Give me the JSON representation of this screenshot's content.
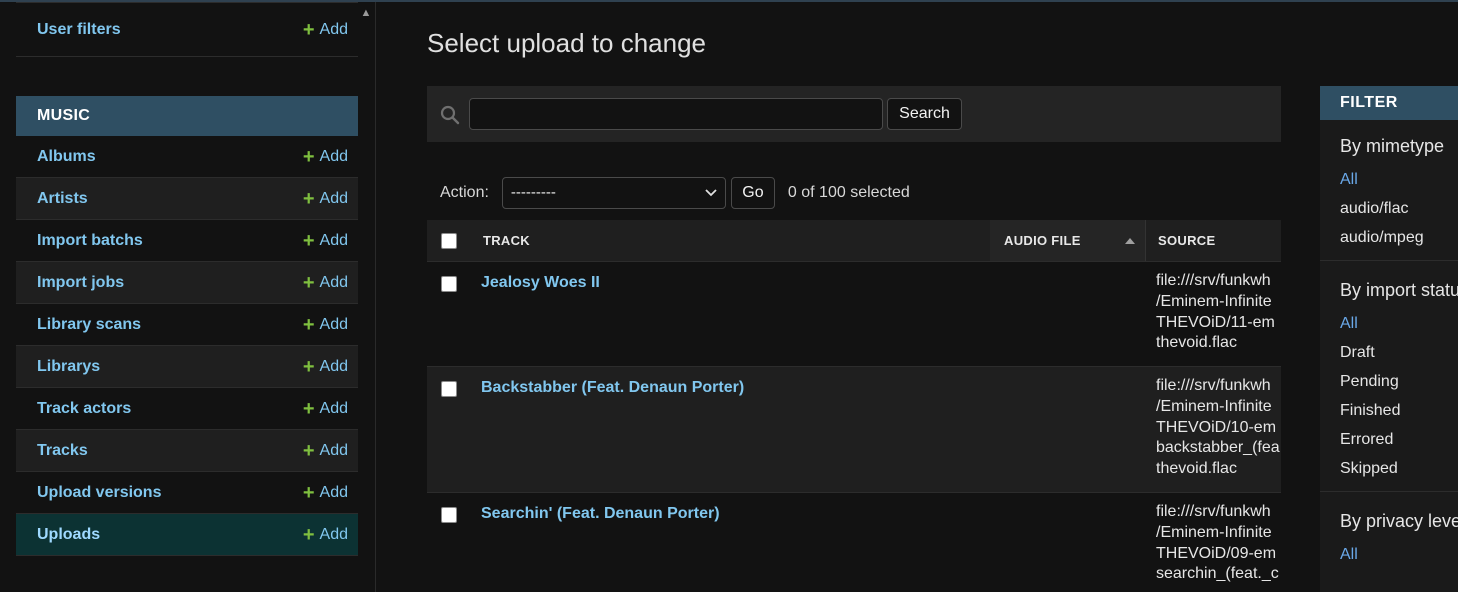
{
  "sidebar": {
    "top_item": {
      "label": "User filters",
      "add": "Add"
    },
    "section": "MUSIC",
    "items": [
      {
        "label": "Albums",
        "add": "Add"
      },
      {
        "label": "Artists",
        "add": "Add"
      },
      {
        "label": "Import batchs",
        "add": "Add"
      },
      {
        "label": "Import jobs",
        "add": "Add"
      },
      {
        "label": "Library scans",
        "add": "Add"
      },
      {
        "label": "Librarys",
        "add": "Add"
      },
      {
        "label": "Track actors",
        "add": "Add"
      },
      {
        "label": "Tracks",
        "add": "Add"
      },
      {
        "label": "Upload versions",
        "add": "Add"
      },
      {
        "label": "Uploads",
        "add": "Add"
      }
    ]
  },
  "main": {
    "title": "Select upload to change",
    "search": {
      "value": "",
      "button": "Search"
    },
    "actions": {
      "label": "Action:",
      "selected_option": "---------",
      "go": "Go",
      "count": "0 of 100 selected"
    },
    "table": {
      "headers": {
        "track": "TRACK",
        "audio_file": "AUDIO FILE",
        "source": "SOURCE"
      },
      "rows": [
        {
          "track": "Jealosy Woes II",
          "source_lines": [
            "file:///srv/funkwh",
            "/Eminem-Infinite",
            "THEVOiD/11-em",
            "thevoid.flac"
          ]
        },
        {
          "track": "Backstabber (Feat. Denaun Porter)",
          "source_lines": [
            "file:///srv/funkwh",
            "/Eminem-Infinite",
            "THEVOiD/10-em",
            "backstabber_(fea",
            "thevoid.flac"
          ]
        },
        {
          "track": "Searchin' (Feat. Denaun Porter)",
          "source_lines": [
            "file:///srv/funkwh",
            "/Eminem-Infinite",
            "THEVOiD/09-em",
            "searchin_(feat._c"
          ]
        }
      ]
    }
  },
  "filter": {
    "title": "FILTER",
    "groups": [
      {
        "title": "By mimetype",
        "options": [
          "All",
          "audio/flac",
          "audio/mpeg"
        ]
      },
      {
        "title": "By import status",
        "options": [
          "All",
          "Draft",
          "Pending",
          "Finished",
          "Errored",
          "Skipped"
        ]
      },
      {
        "title": "By privacy level",
        "options": [
          "All"
        ]
      }
    ]
  },
  "colors": {
    "link": "#81c7ef",
    "section_header": "#2f4f63",
    "add_plus": "#7fbf3f",
    "selected_row": "#0c3233"
  }
}
